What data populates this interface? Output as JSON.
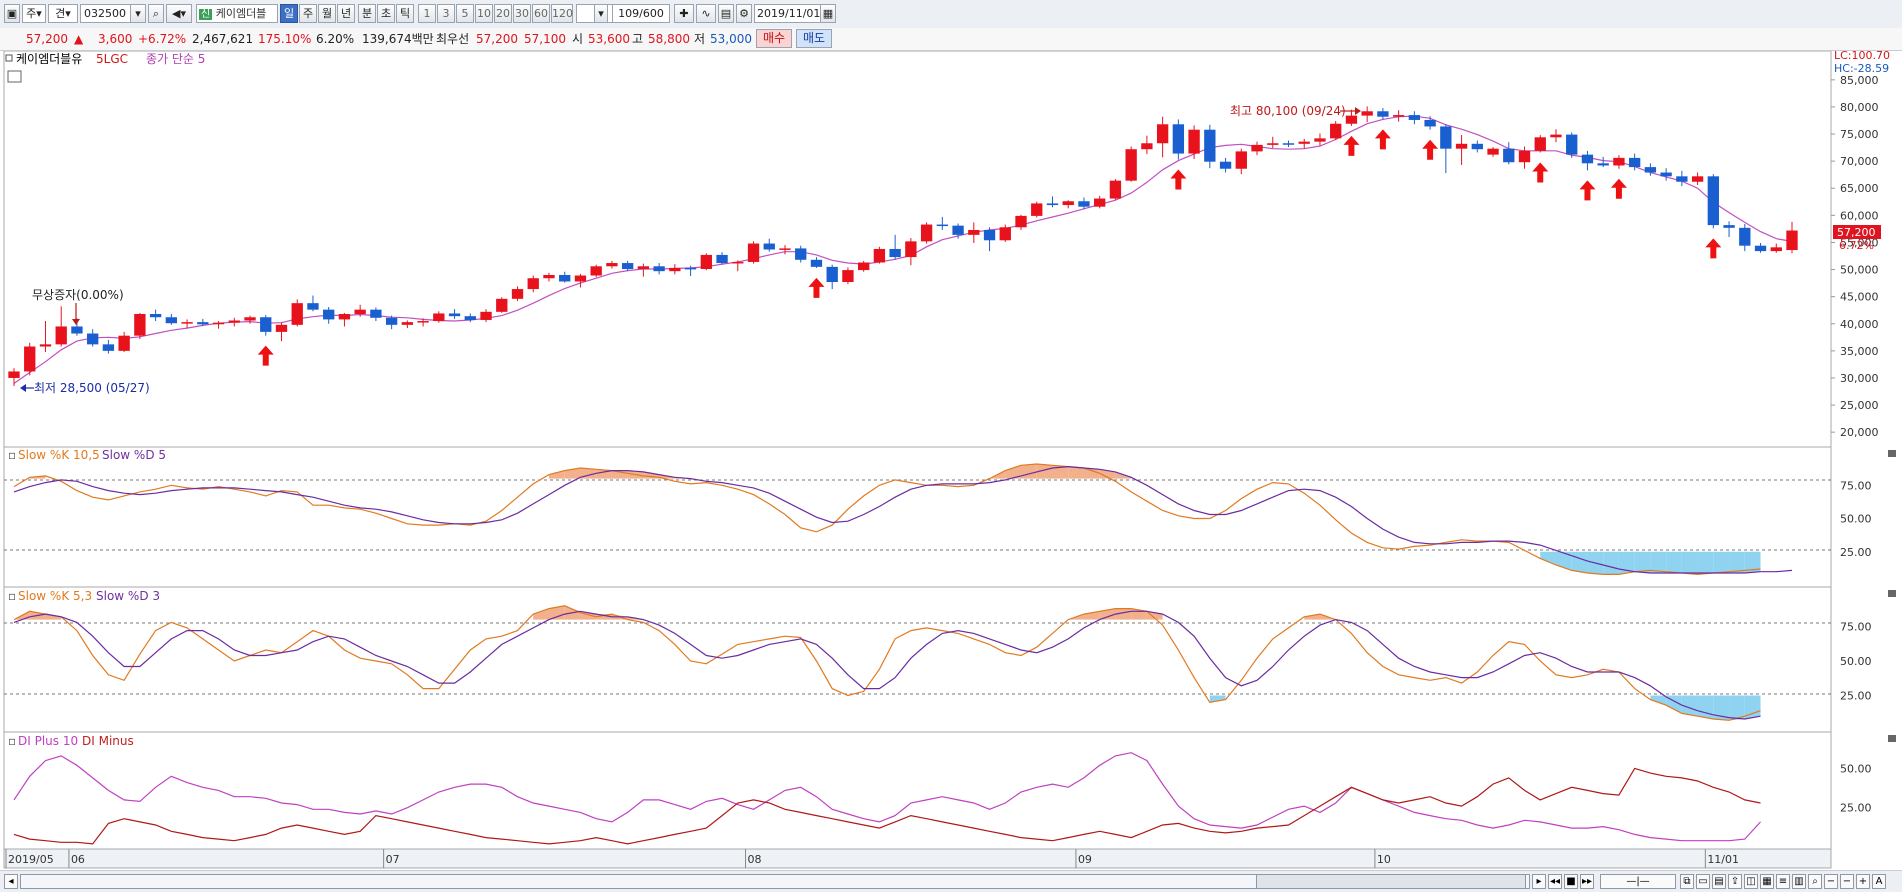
{
  "toolbar": {
    "mode": "주",
    "type": "견",
    "code": "032500",
    "stock_name": "케이엠더블",
    "periods": [
      "일",
      "주",
      "월",
      "년",
      "분",
      "초",
      "틱"
    ],
    "active_period": "일",
    "intervals": [
      "1",
      "3",
      "5",
      "10",
      "20",
      "30",
      "60",
      "120"
    ],
    "bar_count": "109/600",
    "date": "2019/11/01"
  },
  "quote": {
    "price": "57,200",
    "arrow": "▲",
    "change": "3,600",
    "change_pct": "+6.72%",
    "volume": "2,467,621",
    "volume_ratio": "175.10%",
    "turnover": "6.20%",
    "amount": "139,674백만",
    "label_best": "최우선",
    "best_ask": "57,200",
    "best_bid": "57,100",
    "open_label": "시",
    "open": "53,600",
    "high_label": "고",
    "high": "58,800",
    "low_label": "저",
    "low": "53,000",
    "buy_label": "매수",
    "sell_label": "매도"
  },
  "legend": {
    "stock": "케이엠더블유",
    "ma_name": "5LGC",
    "ma_type": "종가 단순 5",
    "stoch1_k": "Slow %K 10,5",
    "stoch1_d": "Slow %D 5",
    "stoch2_k": "Slow %K 5,3",
    "stoch2_d": "Slow %D 3",
    "di_plus": "DI Plus 10",
    "di_minus": "DI Minus"
  },
  "annotations": {
    "high": "최고 80,100 (09/24)",
    "low": "최저 28,500 (05/27)",
    "bonus": "무상증자(0.00%)",
    "lc": "LC:100.70",
    "hc": "HC:-28.59",
    "last_price": "57,200",
    "last_pct": "6.72%"
  },
  "chart_data": {
    "type": "candlestick",
    "price_axis": [
      "85,000",
      "80,000",
      "75,000",
      "70,000",
      "65,000",
      "60,000",
      "55,000",
      "50,000",
      "45,000",
      "40,000",
      "35,000",
      "30,000",
      "25,000",
      "20,000"
    ],
    "price_ylim": [
      18000,
      87000
    ],
    "osc_axis": [
      "75.00",
      "50.00",
      "25.00"
    ],
    "di_axis": [
      "50.00",
      "25.00"
    ],
    "x_labels": [
      {
        "label": "2019/05",
        "i": 0
      },
      {
        "label": "06",
        "i": 4
      },
      {
        "label": "07",
        "i": 24
      },
      {
        "label": "08",
        "i": 47
      },
      {
        "label": "09",
        "i": 68
      },
      {
        "label": "10",
        "i": 87
      },
      {
        "label": "11/01",
        "i": 108
      }
    ],
    "candles": [
      [
        30000,
        31800,
        28500,
        31200
      ],
      [
        31200,
        36500,
        30500,
        35800
      ],
      [
        35800,
        40500,
        34800,
        36200
      ],
      [
        36200,
        43200,
        35800,
        39500
      ],
      [
        39500,
        41000,
        37800,
        38200
      ],
      [
        38200,
        39000,
        35800,
        36200
      ],
      [
        36200,
        37000,
        34500,
        35000
      ],
      [
        35000,
        38500,
        34800,
        37800
      ],
      [
        37800,
        42000,
        37200,
        41800
      ],
      [
        41800,
        42600,
        40500,
        41200
      ],
      [
        41200,
        41800,
        39800,
        40100
      ],
      [
        40100,
        40800,
        39200,
        40300
      ],
      [
        40300,
        40900,
        39600,
        39900
      ],
      [
        39900,
        40500,
        39100,
        40200
      ],
      [
        40200,
        41100,
        39500,
        40600
      ],
      [
        40600,
        41500,
        40000,
        41200
      ],
      [
        41200,
        41600,
        37800,
        38500
      ],
      [
        38500,
        40200,
        36800,
        39800
      ],
      [
        39800,
        44500,
        39500,
        43800
      ],
      [
        43800,
        45200,
        42300,
        42600
      ],
      [
        42600,
        43100,
        40000,
        40800
      ],
      [
        40800,
        42000,
        39500,
        41800
      ],
      [
        41800,
        43500,
        41300,
        42600
      ],
      [
        42600,
        43000,
        40500,
        41100
      ],
      [
        41100,
        41500,
        39000,
        39800
      ],
      [
        39800,
        40600,
        39200,
        40300
      ],
      [
        40300,
        41000,
        39500,
        40500
      ],
      [
        40500,
        42300,
        40200,
        41900
      ],
      [
        41900,
        42700,
        40900,
        41400
      ],
      [
        41400,
        41900,
        40300,
        40700
      ],
      [
        40700,
        42700,
        40300,
        42200
      ],
      [
        42200,
        44900,
        42000,
        44600
      ],
      [
        44600,
        46900,
        44200,
        46400
      ],
      [
        46400,
        48900,
        45800,
        48400
      ],
      [
        48400,
        49400,
        47800,
        49000
      ],
      [
        49000,
        49600,
        47600,
        47800
      ],
      [
        47800,
        49200,
        46700,
        48900
      ],
      [
        48900,
        50900,
        48600,
        50600
      ],
      [
        50600,
        51600,
        50200,
        51200
      ],
      [
        51200,
        51600,
        49700,
        50100
      ],
      [
        50100,
        51100,
        48700,
        50600
      ],
      [
        50600,
        51200,
        49100,
        49700
      ],
      [
        49700,
        51000,
        49100,
        50300
      ],
      [
        50300,
        50700,
        48800,
        50100
      ],
      [
        50100,
        53000,
        49900,
        52700
      ],
      [
        52700,
        53200,
        50900,
        51200
      ],
      [
        51200,
        51700,
        49700,
        51400
      ],
      [
        51400,
        55200,
        51100,
        54800
      ],
      [
        54800,
        55700,
        53300,
        53700
      ],
      [
        53700,
        54500,
        52800,
        53900
      ],
      [
        53900,
        54400,
        51300,
        51800
      ],
      [
        51800,
        52300,
        50300,
        50500
      ],
      [
        50500,
        50900,
        46400,
        47700
      ],
      [
        47700,
        50400,
        47300,
        49900
      ],
      [
        49900,
        51600,
        49600,
        51300
      ],
      [
        51300,
        54200,
        51100,
        53800
      ],
      [
        53800,
        56400,
        51800,
        52300
      ],
      [
        52300,
        55800,
        50800,
        55200
      ],
      [
        55200,
        58700,
        54800,
        58300
      ],
      [
        58300,
        59700,
        57300,
        58100
      ],
      [
        58100,
        58500,
        55700,
        56400
      ],
      [
        56400,
        58700,
        54900,
        57300
      ],
      [
        57300,
        57800,
        53400,
        55400
      ],
      [
        55400,
        58300,
        55100,
        57800
      ],
      [
        57800,
        60100,
        57300,
        59900
      ],
      [
        59900,
        62500,
        59600,
        62200
      ],
      [
        62200,
        63500,
        61500,
        61900
      ],
      [
        61900,
        62800,
        61300,
        62600
      ],
      [
        62600,
        63300,
        61100,
        61600
      ],
      [
        61600,
        63600,
        61300,
        63100
      ],
      [
        63100,
        66700,
        62900,
        66400
      ],
      [
        66400,
        72700,
        66200,
        72200
      ],
      [
        72200,
        74700,
        71300,
        73300
      ],
      [
        73300,
        78200,
        70700,
        76800
      ],
      [
        76800,
        77700,
        70300,
        71400
      ],
      [
        71400,
        76600,
        70400,
        75800
      ],
      [
        75800,
        76700,
        68700,
        69900
      ],
      [
        69900,
        70600,
        67900,
        68600
      ],
      [
        68600,
        72300,
        67600,
        71800
      ],
      [
        71800,
        73600,
        71100,
        73000
      ],
      [
        73000,
        74500,
        72400,
        73300
      ],
      [
        73300,
        73800,
        72600,
        73200
      ],
      [
        73200,
        74100,
        72300,
        73600
      ],
      [
        73600,
        75100,
        72900,
        74200
      ],
      [
        74200,
        77400,
        73900,
        76900
      ],
      [
        76900,
        79500,
        76500,
        78400
      ],
      [
        78400,
        80100,
        77200,
        79200
      ],
      [
        79200,
        79800,
        77700,
        78200
      ],
      [
        78200,
        79400,
        77300,
        78500
      ],
      [
        78500,
        79200,
        76800,
        77600
      ],
      [
        77600,
        78300,
        75800,
        76400
      ],
      [
        76400,
        76800,
        67800,
        72300
      ],
      [
        72300,
        74800,
        69300,
        73200
      ],
      [
        73200,
        73800,
        71600,
        72200
      ],
      [
        71200,
        72600,
        70800,
        72300
      ],
      [
        72300,
        73500,
        69400,
        69800
      ],
      [
        69800,
        72700,
        68600,
        71900
      ],
      [
        71900,
        74800,
        71600,
        74400
      ],
      [
        74400,
        75900,
        73500,
        74900
      ],
      [
        74900,
        75300,
        70600,
        71200
      ],
      [
        71200,
        71900,
        68300,
        69600
      ],
      [
        69600,
        70800,
        68900,
        69200
      ],
      [
        69200,
        71100,
        68600,
        70600
      ],
      [
        70600,
        71400,
        68300,
        68900
      ],
      [
        68900,
        69600,
        67300,
        67900
      ],
      [
        67900,
        68700,
        66400,
        67200
      ],
      [
        67200,
        68200,
        65400,
        66200
      ],
      [
        66200,
        67900,
        65600,
        67200
      ],
      [
        67200,
        67600,
        57600,
        58200
      ],
      [
        58200,
        58900,
        56000,
        57700
      ],
      [
        57700,
        58400,
        53400,
        54400
      ],
      [
        54400,
        54900,
        53100,
        53400
      ],
      [
        53400,
        54800,
        53100,
        54100
      ],
      [
        53600,
        58800,
        53000,
        57200
      ]
    ],
    "ma5": [
      29000,
      31000,
      33000,
      35200,
      36800,
      37400,
      37500,
      37300,
      37600,
      38200,
      38800,
      39200,
      39700,
      40100,
      40300,
      40400,
      40100,
      40200,
      40900,
      41300,
      41600,
      41500,
      41700,
      41500,
      41200,
      41100,
      40800,
      40600,
      40500,
      40700,
      41000,
      41500,
      42500,
      43800,
      45200,
      46500,
      47500,
      48400,
      49300,
      49800,
      50100,
      50100,
      50200,
      50300,
      50500,
      51000,
      51400,
      52000,
      52700,
      53300,
      53300,
      52700,
      51700,
      51200,
      51000,
      51400,
      51900,
      52600,
      54200,
      55500,
      56200,
      56900,
      57300,
      57600,
      58200,
      59000,
      59700,
      60400,
      61200,
      62000,
      62800,
      64100,
      66100,
      68400,
      70100,
      71300,
      72500,
      72900,
      73100,
      72700,
      72300,
      72200,
      72300,
      72800,
      74000,
      75500,
      76900,
      77700,
      78200,
      78300,
      77900,
      76700,
      75900,
      74900,
      73700,
      72300,
      71900,
      71900,
      71900,
      71100,
      70700,
      70100,
      69900,
      69000,
      67900,
      67100,
      66300,
      65000,
      62400,
      60500,
      58700,
      57000,
      55700,
      55200
    ],
    "stoch1_k": [
      74,
      81,
      82,
      78,
      71,
      66,
      64,
      67,
      70,
      72,
      75,
      73,
      72,
      74,
      72,
      70,
      67,
      71,
      70,
      60,
      60,
      58,
      57,
      54,
      50,
      46,
      45,
      45,
      46,
      45,
      48,
      56,
      66,
      76,
      83,
      86,
      88,
      87,
      86,
      84,
      82,
      81,
      78,
      76,
      77,
      75,
      72,
      68,
      61,
      53,
      43,
      40,
      45,
      57,
      67,
      75,
      79,
      77,
      75,
      75,
      74,
      75,
      80,
      86,
      90,
      91,
      90,
      89,
      88,
      84,
      78,
      70,
      63,
      56,
      52,
      50,
      50,
      56,
      65,
      72,
      77,
      76,
      69,
      60,
      49,
      39,
      32,
      28,
      27,
      29,
      30,
      32,
      34,
      33,
      33,
      32,
      26,
      20,
      15,
      11,
      9,
      8,
      8,
      10,
      11,
      10,
      9,
      8,
      9,
      10,
      11,
      12
    ],
    "stoch1_d": [
      70,
      74,
      77,
      79,
      78,
      74,
      71,
      69,
      68,
      69,
      71,
      72,
      73,
      73,
      73,
      72,
      71,
      70,
      68,
      66,
      63,
      60,
      58,
      57,
      55,
      52,
      49,
      47,
      46,
      46,
      47,
      49,
      54,
      61,
      68,
      75,
      81,
      84,
      86,
      86,
      85,
      83,
      81,
      80,
      78,
      77,
      75,
      73,
      69,
      63,
      57,
      51,
      47,
      48,
      53,
      59,
      66,
      72,
      75,
      76,
      76,
      76,
      77,
      79,
      82,
      85,
      88,
      89,
      88,
      87,
      85,
      81,
      75,
      68,
      61,
      56,
      53,
      53,
      56,
      61,
      66,
      71,
      72,
      71,
      66,
      59,
      50,
      42,
      36,
      32,
      31,
      31,
      32,
      32,
      33,
      33,
      32,
      30,
      26,
      22,
      18,
      15,
      12,
      10,
      9,
      9,
      9,
      9,
      9,
      9,
      9,
      10,
      10,
      11
    ],
    "stoch2_k": [
      80,
      86,
      84,
      82,
      72,
      54,
      40,
      36,
      55,
      72,
      78,
      74,
      66,
      58,
      50,
      54,
      58,
      56,
      64,
      72,
      68,
      58,
      52,
      50,
      48,
      40,
      30,
      30,
      44,
      58,
      66,
      68,
      72,
      84,
      88,
      90,
      85,
      82,
      84,
      80,
      78,
      72,
      62,
      50,
      48,
      55,
      62,
      64,
      66,
      68,
      67,
      50,
      30,
      25,
      28,
      44,
      66,
      72,
      74,
      72,
      70,
      66,
      62,
      56,
      54,
      60,
      70,
      80,
      84,
      86,
      88,
      88,
      86,
      76,
      58,
      38,
      20,
      22,
      36,
      52,
      66,
      74,
      82,
      84,
      80,
      70,
      56,
      46,
      40,
      38,
      36,
      38,
      34,
      42,
      54,
      64,
      62,
      50,
      40,
      38,
      40,
      44,
      42,
      30,
      22,
      18,
      12,
      10,
      8,
      7,
      10,
      14
    ],
    "stoch2_d": [
      78,
      82,
      84,
      82,
      78,
      68,
      56,
      46,
      46,
      56,
      66,
      72,
      72,
      66,
      58,
      54,
      54,
      56,
      58,
      64,
      68,
      66,
      60,
      54,
      50,
      46,
      40,
      34,
      34,
      42,
      52,
      62,
      68,
      74,
      80,
      84,
      86,
      84,
      82,
      82,
      80,
      76,
      70,
      62,
      54,
      52,
      54,
      58,
      62,
      64,
      66,
      62,
      52,
      40,
      30,
      30,
      38,
      52,
      62,
      70,
      72,
      70,
      66,
      62,
      58,
      56,
      60,
      66,
      74,
      80,
      84,
      86,
      86,
      84,
      78,
      68,
      52,
      38,
      32,
      36,
      46,
      58,
      68,
      76,
      80,
      78,
      72,
      62,
      52,
      46,
      42,
      40,
      38,
      38,
      42,
      48,
      54,
      56,
      52,
      46,
      42,
      42,
      42,
      38,
      32,
      24,
      18,
      14,
      11,
      9,
      8,
      10
    ],
    "di_plus": [
      30,
      45,
      55,
      58,
      52,
      44,
      36,
      30,
      29,
      38,
      45,
      41,
      38,
      36,
      32,
      32,
      31,
      28,
      27,
      24,
      24,
      22,
      21,
      23,
      21,
      25,
      30,
      35,
      38,
      40,
      40,
      38,
      32,
      28,
      26,
      24,
      22,
      18,
      16,
      22,
      30,
      30,
      27,
      24,
      29,
      31,
      27,
      24,
      30,
      36,
      38,
      32,
      24,
      21,
      18,
      16,
      20,
      28,
      30,
      32,
      30,
      28,
      24,
      28,
      35,
      38,
      40,
      38,
      44,
      52,
      58,
      60,
      55,
      40,
      26,
      18,
      14,
      13,
      12,
      14,
      19,
      24,
      26,
      22,
      28,
      38,
      34,
      30,
      26,
      22,
      20,
      18,
      17,
      14,
      12,
      14,
      17,
      16,
      14,
      12,
      12,
      13,
      11,
      8,
      6,
      5,
      4,
      4,
      4,
      4,
      5,
      16
    ],
    "di_minus": [
      8,
      5,
      4,
      3,
      3,
      2,
      15,
      18,
      16,
      14,
      10,
      8,
      6,
      5,
      4,
      6,
      8,
      12,
      14,
      12,
      10,
      8,
      10,
      20,
      18,
      16,
      14,
      12,
      10,
      8,
      6,
      5,
      4,
      3,
      2,
      3,
      4,
      6,
      4,
      2,
      4,
      6,
      8,
      10,
      12,
      20,
      28,
      30,
      28,
      24,
      22,
      20,
      18,
      16,
      14,
      12,
      16,
      20,
      18,
      16,
      14,
      12,
      10,
      8,
      6,
      5,
      4,
      6,
      8,
      10,
      8,
      6,
      10,
      14,
      15,
      12,
      10,
      9,
      10,
      12,
      13,
      14,
      20,
      26,
      32,
      38,
      34,
      30,
      28,
      30,
      32,
      28,
      26,
      32,
      40,
      44,
      36,
      30,
      34,
      38,
      36,
      34,
      33,
      50,
      47,
      45,
      44,
      42,
      38,
      35,
      30,
      28
    ]
  }
}
